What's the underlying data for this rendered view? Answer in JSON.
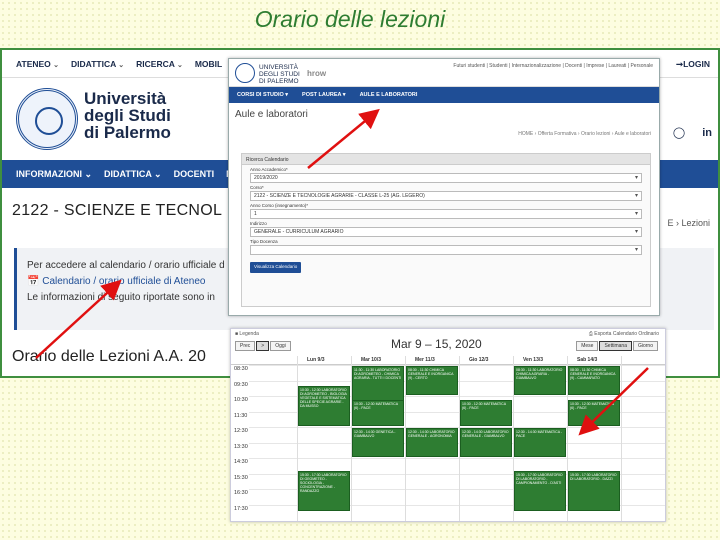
{
  "slide": {
    "title": "Orario delle lezioni"
  },
  "unipa": {
    "topmenu": [
      {
        "label": "ATENEO"
      },
      {
        "label": "DIDATTICA"
      },
      {
        "label": "RICERCA"
      },
      {
        "label": "MOBIL"
      }
    ],
    "login_label": "LOGIN",
    "university_name": [
      "Università",
      "degli Studi",
      "di Palermo"
    ],
    "nav": [
      {
        "label": "INFORMAZIONI"
      },
      {
        "label": "DIDATTICA"
      },
      {
        "label": "DOCENTI"
      },
      {
        "label": "M"
      }
    ],
    "course_title": "2122 - SCIENZE E TECNOL",
    "breadcrumb_fragment": "E › Lezioni",
    "info_lines": [
      "Per accedere al calendario / orario ufficiale d",
      "Calendario / orario ufficiale di Ateneo",
      "Le informazioni di seguito riportate sono in"
    ],
    "orario_title": "Orario delle Lezioni A.A. 20"
  },
  "form": {
    "logo_text": [
      "UNIVERSITÀ",
      "DEGLI STUDI",
      "DI PALERMO"
    ],
    "brand": "hrow",
    "toplinks": "Futuri studenti | Studenti | Internazionalizzazione | Docenti | Imprese | Laureati | Personale",
    "nav": [
      "CORSI DI STUDIO ▾",
      "POST LAUREA ▾",
      "AULE E LABORATORI"
    ],
    "page_title": "Aule e laboratori",
    "breadcrumb": "HOME › Offerta Formativa › Orario lezioni › Aule e laboratori",
    "panel_title": "Ricerca Calendario",
    "fields": [
      {
        "label": "Anno Accademico*",
        "value": "2019/2020"
      },
      {
        "label": "Corso*",
        "value": "2122 - SCIENZE E TECNOLOGIE AGRARIE - CLASSE L-25 (AG. LEGERO)"
      },
      {
        "label": "Anno Corso (insegnamento)*",
        "value": "1"
      },
      {
        "label": "Indirizzo",
        "value": "GENERALE - CURRICULUM AGRARIO"
      },
      {
        "label": "Tipo Docenza",
        "value": ""
      }
    ],
    "submit_label": "Visualizza Calendario"
  },
  "calendar": {
    "legend": "■ Legenda",
    "export": "⎙ Esporta Calendario Ordinario",
    "nav_buttons": [
      "Prec",
      ">",
      "Oggi"
    ],
    "range": "Mar 9 – 15, 2020",
    "views": [
      "Mese",
      "Settimana",
      "Giorno"
    ],
    "active_view": "Settimana",
    "days": [
      "Lun 9/3",
      "Mar 10/3",
      "Mer 11/3",
      "Gio 12/3",
      "Ven 13/3",
      "Sab 14/3"
    ],
    "times": [
      "08:30",
      "09:30",
      "10:30",
      "11:30",
      "12:30",
      "13:30",
      "14:30",
      "15:30",
      "16:30",
      "17:30"
    ],
    "events": [
      {
        "day": 1,
        "start": 0,
        "end": 2.8,
        "text": "11:30 - 11:30 LABORATORIO DI AGROMETEO - CHIMICA AGRARIA - TUTTI I DOCENTI"
      },
      {
        "day": 2,
        "start": 0,
        "end": 2.0,
        "text": "08:30 - 11:30 CHIMICA GENERALE E INORGANICA (9) - CERTO"
      },
      {
        "day": 4,
        "start": 0,
        "end": 2.0,
        "text": "08:30 - 11:30 LABORATORIO CHIMICA AGRARIA - GIAMBALVO"
      },
      {
        "day": 5,
        "start": 0,
        "end": 2.0,
        "text": "08:30 - 11:30 CHIMICA GENERALE E INORGANICA (9) - CAMMARATO"
      },
      {
        "day": 0,
        "start": 1.3,
        "end": 4.0,
        "text": "10:30 - 12:30 LABORATORIO DI AGROMETEO - BIOLOGIA VEGETALE E SISTEMATICA DELLE SPECIE AGRARIE - DA MUSSO"
      },
      {
        "day": 1,
        "start": 2.2,
        "end": 4.0,
        "text": "10:30 - 12:30 MATEMATICA (6) - PACE"
      },
      {
        "day": 3,
        "start": 2.2,
        "end": 4.0,
        "text": "10:30 - 12:30 MATEMATICA (6) - PACE"
      },
      {
        "day": 5,
        "start": 2.2,
        "end": 4.0,
        "text": "10:30 - 12:30 MATEMATICA (6) - PACE"
      },
      {
        "day": 1,
        "start": 4.0,
        "end": 6.0,
        "text": "12:30 - 14:30 GENETICA - GIAMBALVO"
      },
      {
        "day": 2,
        "start": 4.0,
        "end": 6.0,
        "text": "12:30 - 14:30 LABORATORIO GENERALE - AGRONOMIA"
      },
      {
        "day": 3,
        "start": 4.0,
        "end": 6.0,
        "text": "12:30 - 14:30 LABORATORIO GENERALE - GIAMBALVO"
      },
      {
        "day": 4,
        "start": 4.0,
        "end": 6.0,
        "text": "12:30 - 14:30 MATEMATICA - PACE"
      },
      {
        "day": 0,
        "start": 6.8,
        "end": 9.5,
        "text": "15:30 - 17:30 LABORATORIO DI GEOMETEO - SOCIOLOGIA - CONCENTRAZIONE - RANDAZZO"
      },
      {
        "day": 4,
        "start": 6.8,
        "end": 9.5,
        "text": "15:30 - 17:30 LABORATORIO DI LABORATORIO - CAMPIONAMENTO - D'ASTI"
      },
      {
        "day": 5,
        "start": 6.8,
        "end": 9.5,
        "text": "15:30 - 17:30 LABORATORIO DI LABORATORIO - DAZZI"
      }
    ]
  }
}
